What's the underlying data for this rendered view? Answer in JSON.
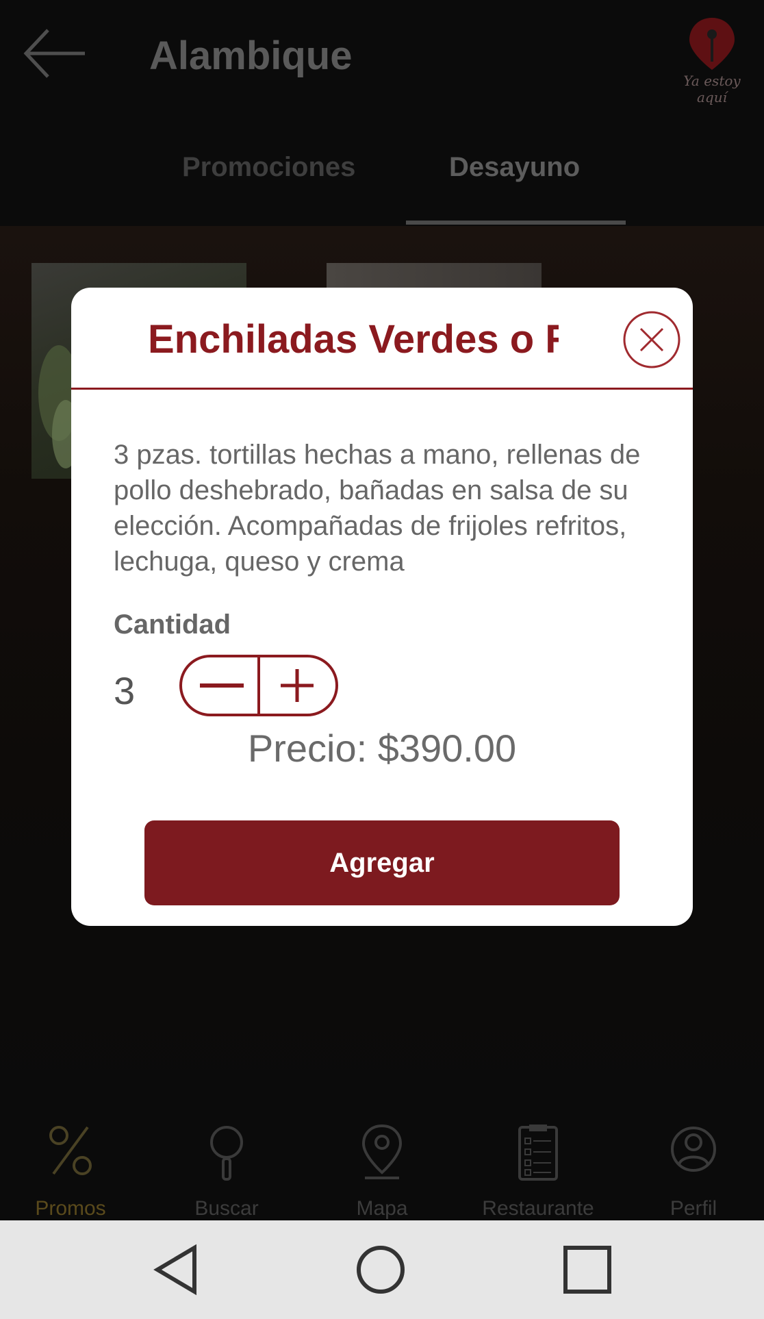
{
  "app": {
    "title": "Alambique",
    "logo_text": "Ya estoy aquí"
  },
  "tabs": [
    {
      "label": "Promociones",
      "active": false
    },
    {
      "label": "Desayuno",
      "active": true
    }
  ],
  "modal": {
    "title": "Enchiladas Verdes o R…",
    "description": "3 pzas. tortillas hechas a mano, rellenas de pollo deshebrado, bañadas en salsa de su elección. Acompañadas de frijoles refritos, lechuga, queso y crema",
    "quantity_label": "Cantidad",
    "quantity": "3",
    "price": "Precio: $390.00",
    "add_button": "Agregar"
  },
  "bottom_nav": [
    {
      "label": "Promos",
      "icon": "percent-icon",
      "active": true
    },
    {
      "label": "Buscar",
      "icon": "search-icon",
      "active": false
    },
    {
      "label": "Mapa",
      "icon": "map-pin-icon",
      "active": false
    },
    {
      "label": "Restaurante",
      "icon": "clipboard-icon",
      "active": false
    },
    {
      "label": "Perfil",
      "icon": "user-icon",
      "active": false
    }
  ],
  "colors": {
    "accent": "#8b1a1f",
    "button": "#7d1a1f",
    "background": "#0b0b0b",
    "system_bar": "#e6e6e6"
  }
}
